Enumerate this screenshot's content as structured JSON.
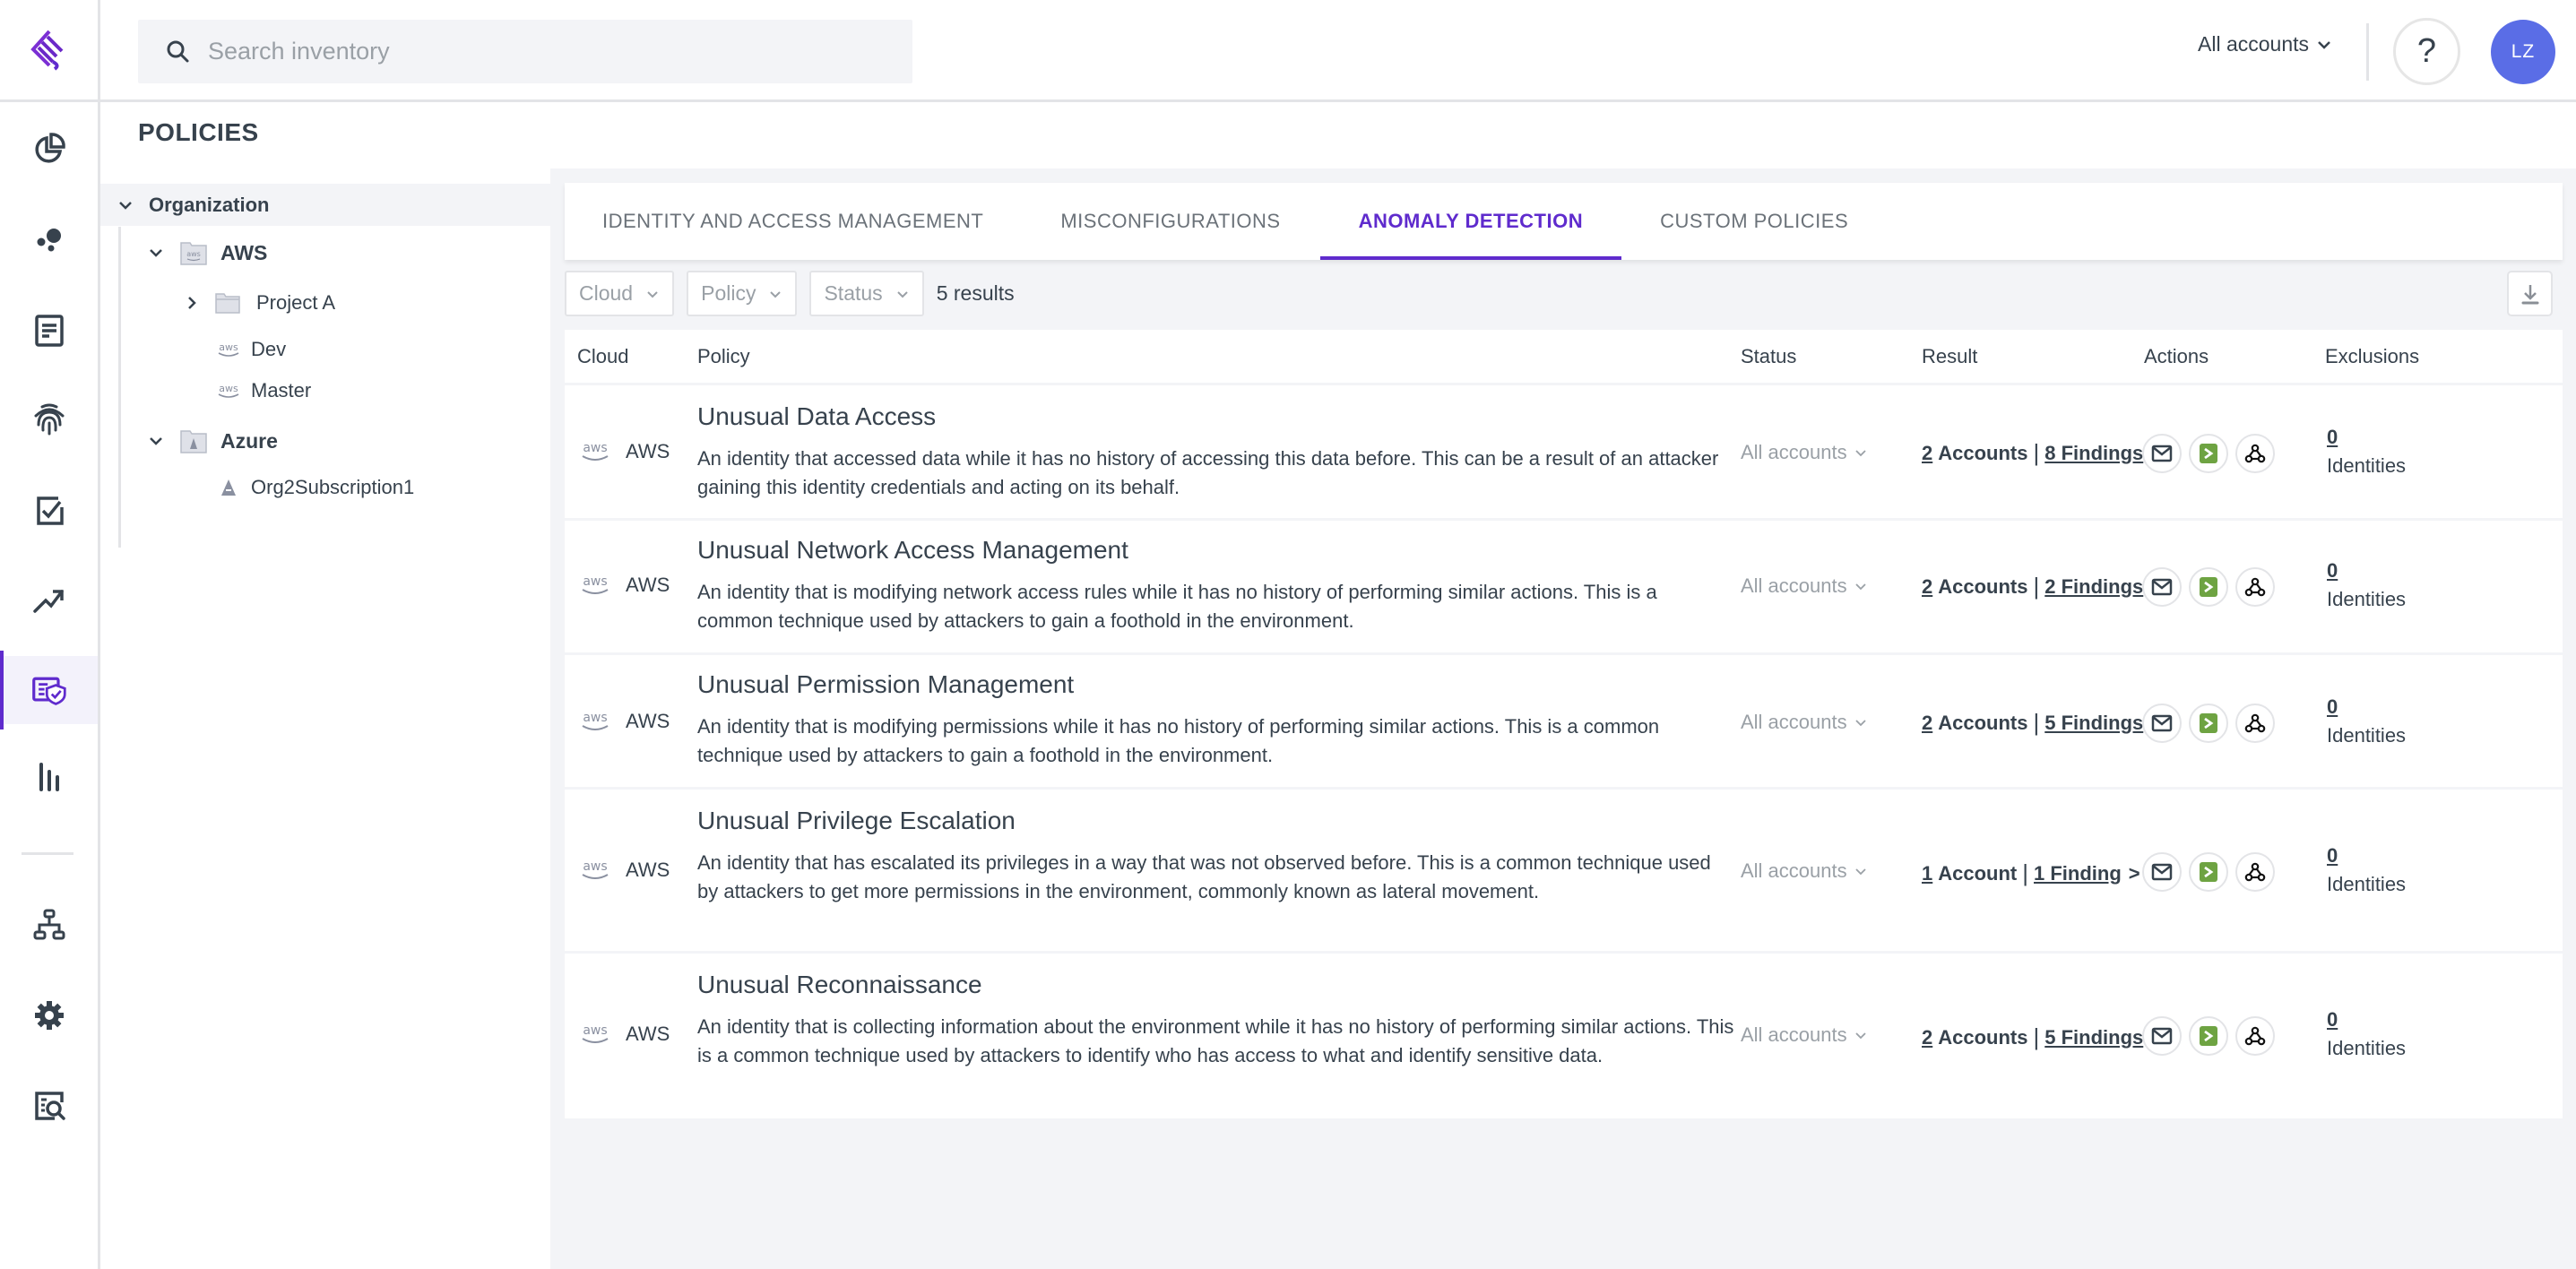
{
  "brand": {
    "logo_icon": "app-logo-icon",
    "accent_color": "#5f2bcd"
  },
  "topbar": {
    "search_placeholder": "Search inventory",
    "search_value": "",
    "accounts_selector": "All accounts",
    "help_label": "?",
    "avatar_initials": "LZ",
    "avatar_color": "#5a6de6"
  },
  "rail": {
    "items": [
      {
        "id": "dashboard",
        "icon": "pie-chart-icon"
      },
      {
        "id": "graph",
        "icon": "bubbles-icon"
      },
      {
        "id": "reports",
        "icon": "document-icon"
      },
      {
        "id": "identities",
        "icon": "fingerprint-icon"
      },
      {
        "id": "tasks",
        "icon": "checkbox-icon"
      },
      {
        "id": "trends",
        "icon": "trending-up-icon"
      },
      {
        "id": "policies",
        "icon": "policy-shield-icon",
        "active": true
      },
      {
        "id": "analytics",
        "icon": "bar-chart-icon"
      },
      {
        "id": "organization",
        "icon": "hierarchy-icon"
      },
      {
        "id": "settings",
        "icon": "gear-icon"
      },
      {
        "id": "audit",
        "icon": "search-document-icon"
      }
    ]
  },
  "page": {
    "title": "POLICIES"
  },
  "tree": {
    "root": "Organization",
    "nodes": [
      {
        "label": "AWS",
        "type": "aws-folder",
        "expanded": true,
        "level": 1
      },
      {
        "label": "Project A",
        "type": "folder",
        "expanded": false,
        "level": 2
      },
      {
        "label": "Dev",
        "type": "aws-account",
        "level": 2
      },
      {
        "label": "Master",
        "type": "aws-account",
        "level": 2
      },
      {
        "label": "Azure",
        "type": "azure-folder",
        "expanded": true,
        "level": 1
      },
      {
        "label": "Org2Subscription1",
        "type": "azure-subscription",
        "level": 2
      }
    ]
  },
  "tabs": [
    {
      "label": "IDENTITY AND ACCESS MANAGEMENT",
      "active": false
    },
    {
      "label": "MISCONFIGURATIONS",
      "active": false
    },
    {
      "label": "ANOMALY DETECTION",
      "active": true
    },
    {
      "label": "CUSTOM POLICIES",
      "active": false
    }
  ],
  "filters": {
    "cloud": "Cloud",
    "policy": "Policy",
    "status": "Status",
    "results": "5 results"
  },
  "table": {
    "headers": {
      "cloud": "Cloud",
      "policy": "Policy",
      "status": "Status",
      "result": "Result",
      "actions": "Actions",
      "exclusions": "Exclusions"
    },
    "rows": [
      {
        "cloud": "AWS",
        "title": "Unusual Data Access",
        "description": "An identity that accessed data while it has no history of accessing this data before. This can be a result of an attacker gaining this identity credentials and acting on its behalf.",
        "status": "All accounts",
        "accounts_count": "2",
        "accounts_label": "Accounts",
        "findings": "8 Findings",
        "exclusions_count": "0",
        "exclusions_label": "Identities"
      },
      {
        "cloud": "AWS",
        "title": "Unusual Network Access Management",
        "description": "An identity that is modifying network access rules while it has no history of performing similar actions. This is a common technique used by attackers to gain a foothold in the environment.",
        "status": "All accounts",
        "accounts_count": "2",
        "accounts_label": "Accounts",
        "findings": "2 Findings",
        "exclusions_count": "0",
        "exclusions_label": "Identities"
      },
      {
        "cloud": "AWS",
        "title": "Unusual Permission Management",
        "description": "An identity that is modifying permissions while it has no history of performing similar actions. This is a common technique used by attackers to gain a foothold in the environment.",
        "status": "All accounts",
        "accounts_count": "2",
        "accounts_label": "Accounts",
        "findings": "5 Findings",
        "exclusions_count": "0",
        "exclusions_label": "Identities"
      },
      {
        "cloud": "AWS",
        "title": "Unusual Privilege Escalation",
        "description": "An identity that has escalated its privileges in a way that was not observed before. This is a common technique used by attackers to get more permissions in the environment, commonly known as lateral movement.",
        "status": "All accounts",
        "accounts_count": "1",
        "accounts_label": "Account",
        "findings": "1 Finding",
        "exclusions_count": "0",
        "exclusions_label": "Identities"
      },
      {
        "cloud": "AWS",
        "title": "Unusual Reconnaissance",
        "description": "An identity that is collecting information about the environment while it has no history of performing similar actions. This is a common technique used by attackers to identify who has access to what and identify sensitive data.",
        "status": "All accounts",
        "accounts_count": "2",
        "accounts_label": "Accounts",
        "findings": "5 Findings",
        "exclusions_count": "0",
        "exclusions_label": "Identities"
      }
    ],
    "row_actions": [
      {
        "icon": "email-icon",
        "label": "Email"
      },
      {
        "icon": "terminal-icon",
        "label": "Script",
        "color": "#6ea342"
      },
      {
        "icon": "webhook-icon",
        "label": "Webhook"
      }
    ],
    "result_arrow": ">"
  }
}
